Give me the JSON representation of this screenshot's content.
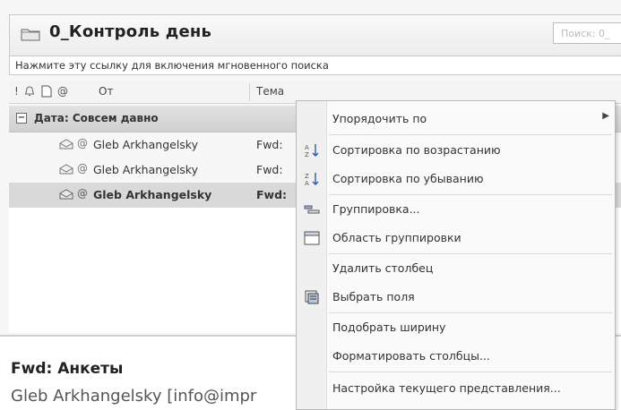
{
  "folder": {
    "title": "0_Контроль день",
    "search_placeholder": "Поиск: 0_"
  },
  "instant_search_link": "Нажмите эту ссылку для включения мгновенного поиска",
  "columns": {
    "from": "От",
    "subject": "Тема"
  },
  "group": {
    "toggle": "−",
    "label": "Дата: Совсем давно"
  },
  "messages": [
    {
      "from": "Gleb Arkhangelsky",
      "subject": "Fwd:",
      "selected": false
    },
    {
      "from": "Gleb Arkhangelsky",
      "subject": "Fwd:",
      "selected": false
    },
    {
      "from": "Gleb Arkhangelsky",
      "subject": "Fwd:",
      "selected": true
    }
  ],
  "reading_pane": {
    "subject": "Fwd: Анкеты",
    "from": "Gleb Arkhangelsky [info@impr"
  },
  "context_menu": {
    "items": [
      {
        "label": "Упорядочить по",
        "icon": "none",
        "submenu": true
      },
      {
        "label": "Сортировка по возрастанию",
        "icon": "sort-ascending-icon"
      },
      {
        "label": "Сортировка по убыванию",
        "icon": "sort-descending-icon"
      },
      {
        "label": "Группировка...",
        "icon": "group-by-icon"
      },
      {
        "label": "Область группировки",
        "icon": "group-area-icon"
      },
      {
        "label": "Удалить столбец",
        "icon": "none"
      },
      {
        "label": "Выбрать поля",
        "icon": "field-chooser-icon"
      },
      {
        "label": "Подобрать ширину",
        "icon": "none"
      },
      {
        "label": "Форматировать столбцы...",
        "icon": "none"
      },
      {
        "label": "Настройка текущего представления...",
        "icon": "none"
      }
    ]
  }
}
